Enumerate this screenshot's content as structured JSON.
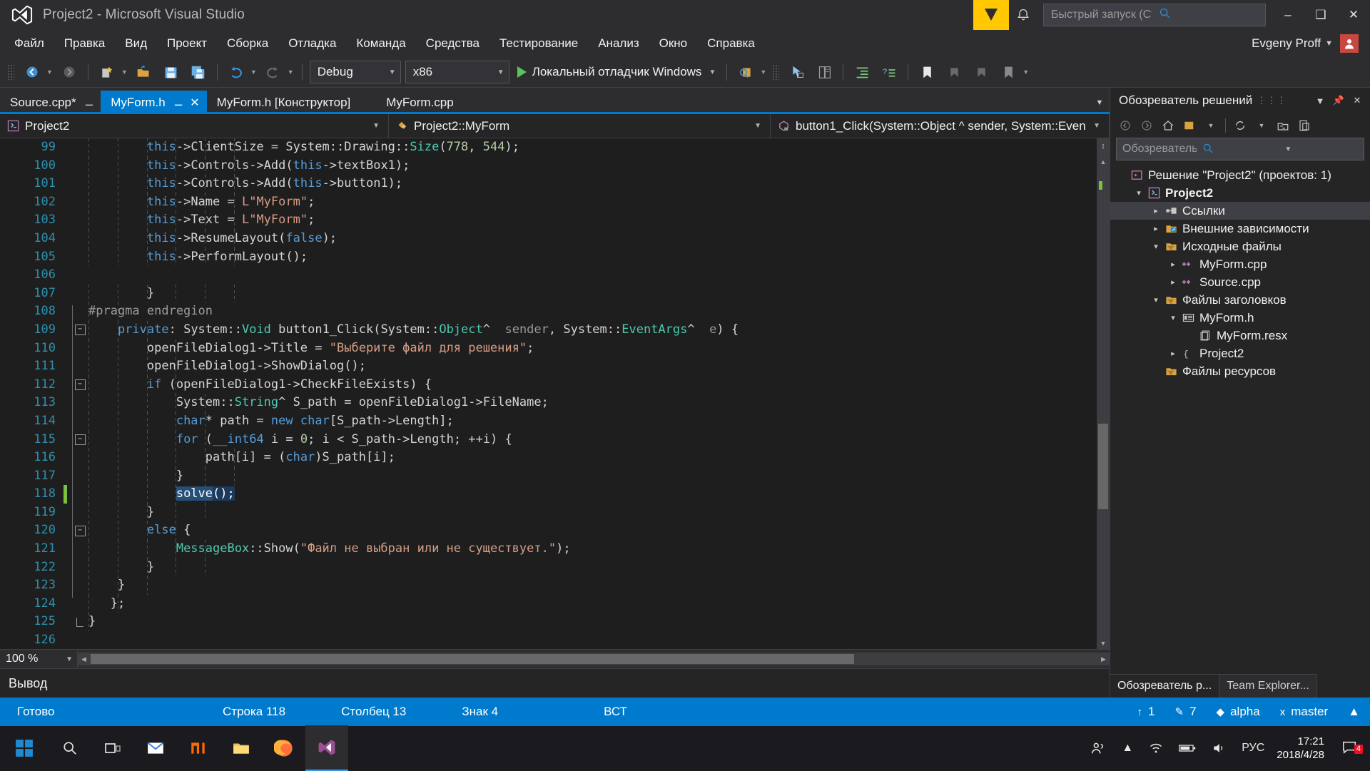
{
  "window": {
    "title": "Project2 - Microsoft Visual Studio",
    "logo_icon": "visual-studio-logo",
    "minimize_label": "–",
    "maximize_label": "❑",
    "close_label": "✕",
    "feedback_icon": "feedback-smiley-icon",
    "notify_icon": "notifications-bell-icon"
  },
  "quick_launch": {
    "placeholder": "Быстрый запуск (Ctrl+Q)",
    "icon": "search-icon"
  },
  "menu": {
    "items": [
      {
        "label": "Файл"
      },
      {
        "label": "Правка"
      },
      {
        "label": "Вид"
      },
      {
        "label": "Проект"
      },
      {
        "label": "Сборка"
      },
      {
        "label": "Отладка"
      },
      {
        "label": "Команда"
      },
      {
        "label": "Средства"
      },
      {
        "label": "Тестирование"
      },
      {
        "label": "Анализ"
      },
      {
        "label": "Окно"
      },
      {
        "label": "Справка"
      }
    ],
    "user_name": "Evgeny Proff"
  },
  "toolbar": {
    "config_value": "Debug",
    "platform_value": "x86",
    "run_label": "Локальный отладчик Windows",
    "icons": [
      "navigate-back-icon",
      "navigate-forward-icon",
      "new-item-icon",
      "open-file-icon",
      "save-icon",
      "save-all-icon",
      "undo-icon",
      "redo-icon"
    ]
  },
  "tabs": [
    {
      "label": "Source.cpp*",
      "active": false,
      "pinned": true,
      "closable": false
    },
    {
      "label": "MyForm.h",
      "active": true,
      "pinned": true,
      "closable": true
    },
    {
      "label": "MyForm.h [Конструктор]",
      "active": false,
      "pinned": false,
      "closable": false
    },
    {
      "label": "MyForm.cpp",
      "active": false,
      "pinned": false,
      "closable": false
    }
  ],
  "navbar": {
    "project": "Project2",
    "class": "Project2::MyForm",
    "member": "button1_Click(System::Object ^ sender, System::Even"
  },
  "editor": {
    "zoom_level": "100 %",
    "lines": [
      {
        "num": "99",
        "indent": 6,
        "fold": "",
        "modified": false,
        "tokens": [
          {
            "t": "        ",
            "c": "id"
          },
          {
            "t": "this",
            "c": "k"
          },
          {
            "t": "->ClientSize = System::Drawing::",
            "c": "id"
          },
          {
            "t": "Size",
            "c": "t"
          },
          {
            "t": "(",
            "c": "id"
          },
          {
            "t": "778",
            "c": "n"
          },
          {
            "t": ", ",
            "c": "id"
          },
          {
            "t": "544",
            "c": "n"
          },
          {
            "t": ");",
            "c": "id"
          }
        ]
      },
      {
        "num": "100",
        "indent": 6,
        "fold": "",
        "modified": false,
        "tokens": [
          {
            "t": "        ",
            "c": "id"
          },
          {
            "t": "this",
            "c": "k"
          },
          {
            "t": "->Controls->Add(",
            "c": "id"
          },
          {
            "t": "this",
            "c": "k"
          },
          {
            "t": "->textBox1);",
            "c": "id"
          }
        ]
      },
      {
        "num": "101",
        "indent": 6,
        "fold": "",
        "modified": false,
        "tokens": [
          {
            "t": "        ",
            "c": "id"
          },
          {
            "t": "this",
            "c": "k"
          },
          {
            "t": "->Controls->Add(",
            "c": "id"
          },
          {
            "t": "this",
            "c": "k"
          },
          {
            "t": "->button1);",
            "c": "id"
          }
        ]
      },
      {
        "num": "102",
        "indent": 6,
        "fold": "",
        "modified": false,
        "tokens": [
          {
            "t": "        ",
            "c": "id"
          },
          {
            "t": "this",
            "c": "k"
          },
          {
            "t": "->Name = ",
            "c": "id"
          },
          {
            "t": "L\"MyForm\"",
            "c": "s"
          },
          {
            "t": ";",
            "c": "id"
          }
        ]
      },
      {
        "num": "103",
        "indent": 6,
        "fold": "",
        "modified": false,
        "tokens": [
          {
            "t": "        ",
            "c": "id"
          },
          {
            "t": "this",
            "c": "k"
          },
          {
            "t": "->Text = ",
            "c": "id"
          },
          {
            "t": "L\"MyForm\"",
            "c": "s"
          },
          {
            "t": ";",
            "c": "id"
          }
        ]
      },
      {
        "num": "104",
        "indent": 6,
        "fold": "",
        "modified": false,
        "tokens": [
          {
            "t": "        ",
            "c": "id"
          },
          {
            "t": "this",
            "c": "k"
          },
          {
            "t": "->ResumeLayout(",
            "c": "id"
          },
          {
            "t": "false",
            "c": "k"
          },
          {
            "t": ");",
            "c": "id"
          }
        ]
      },
      {
        "num": "105",
        "indent": 6,
        "fold": "",
        "modified": false,
        "tokens": [
          {
            "t": "        ",
            "c": "id"
          },
          {
            "t": "this",
            "c": "k"
          },
          {
            "t": "->PerformLayout();",
            "c": "id"
          }
        ]
      },
      {
        "num": "106",
        "indent": 6,
        "fold": "",
        "modified": false,
        "tokens": []
      },
      {
        "num": "107",
        "indent": 6,
        "fold": "",
        "modified": false,
        "tokens": [
          {
            "t": "        }",
            "c": "id"
          }
        ]
      },
      {
        "num": "108",
        "indent": 2,
        "fold": "",
        "modified": false,
        "tokens": [
          {
            "t": "#pragma endregion",
            "c": "p"
          }
        ]
      },
      {
        "num": "109",
        "indent": 3,
        "fold": "minus",
        "modified": false,
        "tokens": [
          {
            "t": "    ",
            "c": "id"
          },
          {
            "t": "private",
            "c": "k"
          },
          {
            "t": ": System::",
            "c": "id"
          },
          {
            "t": "Void",
            "c": "t"
          },
          {
            "t": " button1_Click(System::",
            "c": "id"
          },
          {
            "t": "Object",
            "c": "t"
          },
          {
            "t": "^  ",
            "c": "id"
          },
          {
            "t": "sender",
            "c": "param"
          },
          {
            "t": ", System::",
            "c": "id"
          },
          {
            "t": "EventArgs",
            "c": "t"
          },
          {
            "t": "^  ",
            "c": "id"
          },
          {
            "t": "e",
            "c": "param"
          },
          {
            "t": ") {",
            "c": "id"
          }
        ]
      },
      {
        "num": "110",
        "indent": 4,
        "fold": "",
        "modified": false,
        "tokens": [
          {
            "t": "        openFileDialog1->Title = ",
            "c": "id"
          },
          {
            "t": "\"Выберите файл для решения\"",
            "c": "s"
          },
          {
            "t": ";",
            "c": "id"
          }
        ]
      },
      {
        "num": "111",
        "indent": 4,
        "fold": "",
        "modified": false,
        "tokens": [
          {
            "t": "        openFileDialog1->ShowDialog();",
            "c": "id"
          }
        ]
      },
      {
        "num": "112",
        "indent": 4,
        "fold": "minus",
        "modified": false,
        "tokens": [
          {
            "t": "        ",
            "c": "id"
          },
          {
            "t": "if",
            "c": "k"
          },
          {
            "t": " (openFileDialog1->CheckFileExists) {",
            "c": "id"
          }
        ]
      },
      {
        "num": "113",
        "indent": 5,
        "fold": "",
        "modified": false,
        "tokens": [
          {
            "t": "            System::",
            "c": "id"
          },
          {
            "t": "String",
            "c": "t"
          },
          {
            "t": "^ S_path = openFileDialog1->FileName;",
            "c": "id"
          }
        ]
      },
      {
        "num": "114",
        "indent": 5,
        "fold": "",
        "modified": false,
        "tokens": [
          {
            "t": "            ",
            "c": "id"
          },
          {
            "t": "char",
            "c": "k"
          },
          {
            "t": "* path = ",
            "c": "id"
          },
          {
            "t": "new",
            "c": "k"
          },
          {
            "t": " ",
            "c": "id"
          },
          {
            "t": "char",
            "c": "k"
          },
          {
            "t": "[S_path->Length];",
            "c": "id"
          }
        ]
      },
      {
        "num": "115",
        "indent": 5,
        "fold": "minus",
        "modified": false,
        "tokens": [
          {
            "t": "            ",
            "c": "id"
          },
          {
            "t": "for",
            "c": "k"
          },
          {
            "t": " (",
            "c": "id"
          },
          {
            "t": "__int64",
            "c": "k"
          },
          {
            "t": " i = ",
            "c": "id"
          },
          {
            "t": "0",
            "c": "n"
          },
          {
            "t": "; i < S_path->Length; ++i) {",
            "c": "id"
          }
        ]
      },
      {
        "num": "116",
        "indent": 6,
        "fold": "",
        "modified": false,
        "tokens": [
          {
            "t": "                path[i] = (",
            "c": "id"
          },
          {
            "t": "char",
            "c": "k"
          },
          {
            "t": ")S_path[i];",
            "c": "id"
          }
        ]
      },
      {
        "num": "117",
        "indent": 6,
        "fold": "",
        "modified": false,
        "tokens": [
          {
            "t": "            }",
            "c": "id"
          }
        ]
      },
      {
        "num": "118",
        "indent": 5,
        "fold": "",
        "modified": true,
        "selection": {
          "text": "solve",
          "prefix": "            ",
          "suffix": "();"
        },
        "tokens": []
      },
      {
        "num": "119",
        "indent": 5,
        "fold": "",
        "modified": false,
        "tokens": [
          {
            "t": "        }",
            "c": "id"
          }
        ]
      },
      {
        "num": "120",
        "indent": 4,
        "fold": "minus",
        "modified": false,
        "tokens": [
          {
            "t": "        ",
            "c": "id"
          },
          {
            "t": "else",
            "c": "k"
          },
          {
            "t": " {",
            "c": "id"
          }
        ]
      },
      {
        "num": "121",
        "indent": 5,
        "fold": "",
        "modified": false,
        "tokens": [
          {
            "t": "            ",
            "c": "id"
          },
          {
            "t": "MessageBox",
            "c": "t"
          },
          {
            "t": "::Show(",
            "c": "id"
          },
          {
            "t": "\"Файл не выбран или не существует.\"",
            "c": "s"
          },
          {
            "t": ");",
            "c": "id"
          }
        ]
      },
      {
        "num": "122",
        "indent": 5,
        "fold": "",
        "modified": false,
        "tokens": [
          {
            "t": "        }",
            "c": "id"
          }
        ]
      },
      {
        "num": "123",
        "indent": 3,
        "fold": "",
        "modified": false,
        "tokens": [
          {
            "t": "    }",
            "c": "id"
          }
        ]
      },
      {
        "num": "124",
        "indent": 2,
        "fold": "",
        "modified": false,
        "tokens": [
          {
            "t": "   };",
            "c": "id"
          }
        ]
      },
      {
        "num": "125",
        "indent": 1,
        "fold": "end",
        "modified": false,
        "tokens": [
          {
            "t": "}",
            "c": "id"
          }
        ]
      },
      {
        "num": "126",
        "indent": 0,
        "fold": "",
        "modified": false,
        "tokens": []
      }
    ]
  },
  "output": {
    "label": "Вывод"
  },
  "solution_explorer": {
    "title": "Обозреватель решений",
    "search_placeholder": "Обозреватель решений — поиск",
    "tree": [
      {
        "label": "Решение \"Project2\"  (проектов: 1)",
        "depth": 0,
        "expander": "",
        "icon": "solution-icon",
        "bold": false,
        "selected": false
      },
      {
        "label": "Project2",
        "depth": 1,
        "expander": "down",
        "icon": "cpp-project-icon",
        "bold": true,
        "selected": false
      },
      {
        "label": "Ссылки",
        "depth": 2,
        "expander": "right",
        "icon": "references-icon",
        "bold": false,
        "selected": true
      },
      {
        "label": "Внешние зависимости",
        "depth": 2,
        "expander": "right",
        "icon": "external-deps-icon",
        "bold": false,
        "selected": false
      },
      {
        "label": "Исходные файлы",
        "depth": 2,
        "expander": "down",
        "icon": "filter-folder-icon",
        "bold": false,
        "selected": false
      },
      {
        "label": "MyForm.cpp",
        "depth": 3,
        "expander": "right",
        "icon": "cpp-file-icon",
        "bold": false,
        "selected": false
      },
      {
        "label": "Source.cpp",
        "depth": 3,
        "expander": "right",
        "icon": "cpp-file-icon",
        "bold": false,
        "selected": false
      },
      {
        "label": "Файлы заголовков",
        "depth": 2,
        "expander": "down",
        "icon": "filter-folder-icon",
        "bold": false,
        "selected": false
      },
      {
        "label": "MyForm.h",
        "depth": 3,
        "expander": "down",
        "icon": "header-file-icon",
        "bold": false,
        "selected": false
      },
      {
        "label": "MyForm.resx",
        "depth": 4,
        "expander": "",
        "icon": "resx-file-icon",
        "bold": false,
        "selected": false
      },
      {
        "label": "Project2",
        "depth": 3,
        "expander": "right",
        "icon": "braces-icon",
        "bold": false,
        "selected": false
      },
      {
        "label": "Файлы ресурсов",
        "depth": 2,
        "expander": "",
        "icon": "filter-folder-icon",
        "bold": false,
        "selected": false
      }
    ],
    "bottom_tabs": [
      {
        "label": "Обозреватель р...",
        "active": true
      },
      {
        "label": "Team Explorer...",
        "active": false
      }
    ]
  },
  "statusbar": {
    "ready": "Готово",
    "line": "Строка 118",
    "column": "Столбец 13",
    "char": "Знак 4",
    "insert_mode": "ВСТ",
    "pending_up": "1",
    "pending_edits": "7",
    "repo": "alpha",
    "branch": "master"
  },
  "taskbar": {
    "items": [
      {
        "icon": "windows-start-icon",
        "name": "start-button",
        "active": false
      },
      {
        "icon": "search-icon",
        "name": "taskbar-search",
        "active": false
      },
      {
        "icon": "task-view-icon",
        "name": "task-view",
        "active": false
      },
      {
        "icon": "mail-icon",
        "name": "taskbar-mail",
        "active": false
      },
      {
        "icon": "mi-browser-icon",
        "name": "taskbar-mi",
        "active": false
      },
      {
        "icon": "file-explorer-icon",
        "name": "taskbar-explorer",
        "active": false
      },
      {
        "icon": "firefox-icon",
        "name": "taskbar-firefox",
        "active": false
      },
      {
        "icon": "visual-studio-icon",
        "name": "taskbar-visual-studio",
        "active": true
      }
    ],
    "tray": {
      "people_icon": "people-icon",
      "chevron_icon": "show-hidden-icons",
      "network_icon": "wifi-icon",
      "battery_icon": "battery-icon",
      "volume_icon": "speaker-icon",
      "language": "РУС",
      "time": "17:21",
      "date": "2018/4/28",
      "notification_count": "4",
      "notification_icon": "action-center-icon"
    }
  },
  "colors": {
    "accent": "#007acc",
    "titlebar_bg": "#2d2d30",
    "editor_bg": "#1e1e1e",
    "feedback_yellow": "#ffc801",
    "change_green": "#7ac043",
    "selection_blue": "#264f78"
  }
}
